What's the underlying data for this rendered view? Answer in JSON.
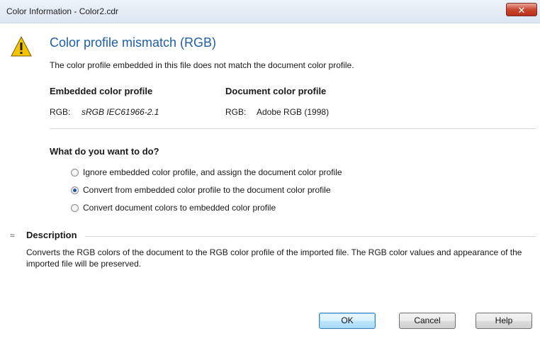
{
  "window": {
    "title": "Color Information - Color2.cdr",
    "close_glyph": "✕"
  },
  "header": {
    "headline": "Color profile mismatch (RGB)",
    "subtext": "The color profile embedded in this file does not match the document color profile.",
    "icon": "warning-triangle-icon"
  },
  "profiles": {
    "embedded_heading": "Embedded color profile",
    "embedded_label": "RGB:",
    "embedded_value": "sRGB IEC61966-2.1",
    "document_heading": "Document color profile",
    "document_label": "RGB:",
    "document_value": "Adobe RGB (1998)"
  },
  "options": {
    "question": "What do you want to do?",
    "items": [
      {
        "label": "Ignore embedded color profile, and assign the document color profile",
        "checked": false
      },
      {
        "label": "Convert from embedded color profile to the document color profile",
        "checked": true
      },
      {
        "label": "Convert document colors to embedded color profile",
        "checked": false
      }
    ]
  },
  "description": {
    "toggle_glyph": "≈",
    "title": "Description",
    "body": "Converts the RGB colors of the document to the RGB color profile of the imported file. The RGB color values and appearance of the imported file will be preserved."
  },
  "buttons": {
    "ok": "OK",
    "cancel": "Cancel",
    "help": "Help"
  }
}
